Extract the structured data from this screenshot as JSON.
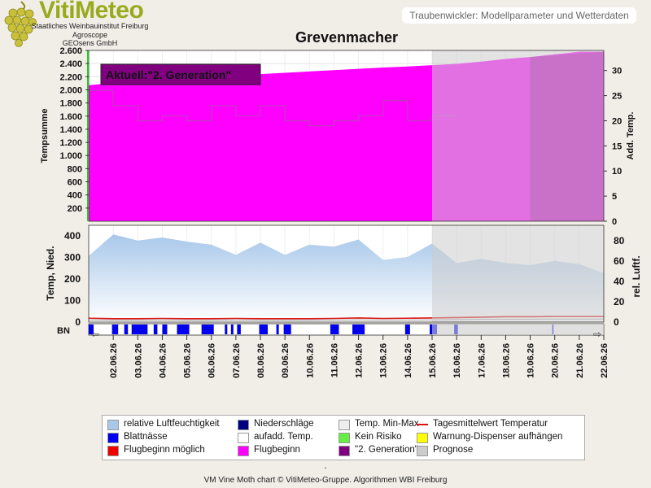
{
  "header": {
    "logo_title": "VitiMeteo",
    "logo_lines": [
      "Staatliches Weinbauinstitut Freiburg",
      "Agroscope",
      "GEOsens GmbH"
    ],
    "tag": "Traubenwickler: Modellparameter und Wetterdaten"
  },
  "footer": {
    "dash": "-",
    "credit": "VM Vine Moth chart © VitiMeteo-Gruppe. Algorithmen WBI Freiburg"
  },
  "colors": {
    "flugbeginn": "#ff00ff",
    "generation2": "#800080",
    "prognose": "#cccccc",
    "humidity": "#a8c8ea",
    "temp_line": "#dd1111",
    "blattnaesse": "#0000ee",
    "niederschlaege": "#000080"
  },
  "chart_data": [
    {
      "type": "area",
      "title": "Grevenmacher",
      "ylabel": "Tempsumme",
      "y2label": "Add. Temp.",
      "ylim": [
        0,
        2600
      ],
      "y2lim": [
        0,
        34
      ],
      "yticks": [
        "200",
        "400",
        "600",
        "800",
        "1.000",
        "1.200",
        "1.400",
        "1.600",
        "1.800",
        "2.000",
        "2.200",
        "2.400",
        "2.600"
      ],
      "y2ticks": [
        "0",
        "5",
        "10",
        "15",
        "20",
        "25",
        "30"
      ],
      "annotation": "Aktuell:\"2. Generation\"",
      "x": [
        "02.06.26",
        "03.06.26",
        "04.06.26",
        "05.06.26",
        "06.06.26",
        "07.06.26",
        "08.06.26",
        "09.06.26",
        "10.06.26",
        "11.06.26",
        "12.06.26",
        "13.06.26",
        "14.06.26",
        "15.06.26",
        "16.06.26",
        "17.06.26",
        "18.06.26",
        "19.06.26",
        "20.06.26",
        "21.06.26",
        "22.06.26"
      ],
      "x_start": "01.06.26",
      "x_end": "22.06.26",
      "tempsumme": [
        2070,
        2105,
        2130,
        2155,
        2180,
        2200,
        2220,
        2240,
        2260,
        2280,
        2300,
        2320,
        2340,
        2355,
        2375,
        2395,
        2430,
        2470,
        2500,
        2540,
        2580
      ],
      "add_temp": [
        26,
        23,
        20,
        21,
        20,
        23,
        21,
        23,
        20,
        19,
        20,
        21,
        24,
        20,
        21
      ],
      "prognose_start": "15.06.26",
      "generation2_from": "19.06.26"
    },
    {
      "type": "area",
      "ylabel": "Temp, Nied.",
      "y2label": "rel. Luftf.",
      "ylim": [
        0,
        450
      ],
      "y2lim": [
        0,
        95
      ],
      "yticks": [
        "0",
        "100",
        "200",
        "300",
        "400"
      ],
      "y2ticks": [
        "0",
        "20",
        "40",
        "60",
        "80"
      ],
      "humidity": [
        65,
        86,
        80,
        83,
        79,
        76,
        66,
        78,
        66,
        76,
        74,
        81,
        61,
        64,
        77,
        58,
        62,
        58,
        56,
        60,
        57,
        48
      ],
      "temperature": [
        18,
        16,
        16,
        17,
        16,
        16,
        17,
        16,
        16,
        16,
        17,
        19,
        17,
        18,
        19,
        21,
        23,
        25,
        25,
        26,
        26,
        26
      ]
    },
    {
      "type": "bar",
      "ylabel": "BN",
      "blattnaesse_intervals": [
        [
          0.0,
          0.2
        ],
        [
          0.95,
          1.2
        ],
        [
          1.45,
          1.6
        ],
        [
          1.75,
          2.4
        ],
        [
          2.65,
          2.8
        ],
        [
          3.0,
          3.2
        ],
        [
          3.6,
          4.1
        ],
        [
          4.6,
          5.1
        ],
        [
          5.55,
          5.65
        ],
        [
          5.8,
          5.9
        ],
        [
          6.05,
          6.2
        ],
        [
          6.95,
          7.3
        ],
        [
          7.65,
          7.75
        ],
        [
          7.95,
          8.25
        ],
        [
          9.85,
          10.2
        ],
        [
          10.75,
          11.25
        ],
        [
          12.9,
          13.1
        ],
        [
          13.9,
          14.2
        ],
        [
          14.9,
          15.05
        ],
        [
          18.9,
          18.95
        ]
      ]
    }
  ],
  "legend": {
    "items": [
      {
        "label": "relative Luftfeuchtigkeit",
        "color": "#a8c8ea",
        "kind": "box"
      },
      {
        "label": "Niederschläge",
        "color": "#000080",
        "kind": "box"
      },
      {
        "label": "Temp. Min-Max",
        "color": "#eeeeee",
        "kind": "box"
      },
      {
        "label": "Tagesmittelwert Temperatur",
        "color": "#dd1111",
        "kind": "line"
      },
      {
        "label": "Blattnässe",
        "color": "#0000ee",
        "kind": "box"
      },
      {
        "label": "aufadd. Temp.",
        "color": "#ffffff",
        "kind": "box"
      },
      {
        "label": "Kein Risiko",
        "color": "#66ee44",
        "kind": "box"
      },
      {
        "label": "Warnung-Dispenser aufhängen",
        "color": "#ffff00",
        "kind": "box"
      },
      {
        "label": "Flugbeginn möglich",
        "color": "#ee0000",
        "kind": "box"
      },
      {
        "label": "Flugbeginn",
        "color": "#ff00ff",
        "kind": "box"
      },
      {
        "label": "\"2. Generation\"",
        "color": "#800080",
        "kind": "box"
      },
      {
        "label": "Prognose",
        "color": "#cccccc",
        "kind": "box"
      }
    ]
  }
}
